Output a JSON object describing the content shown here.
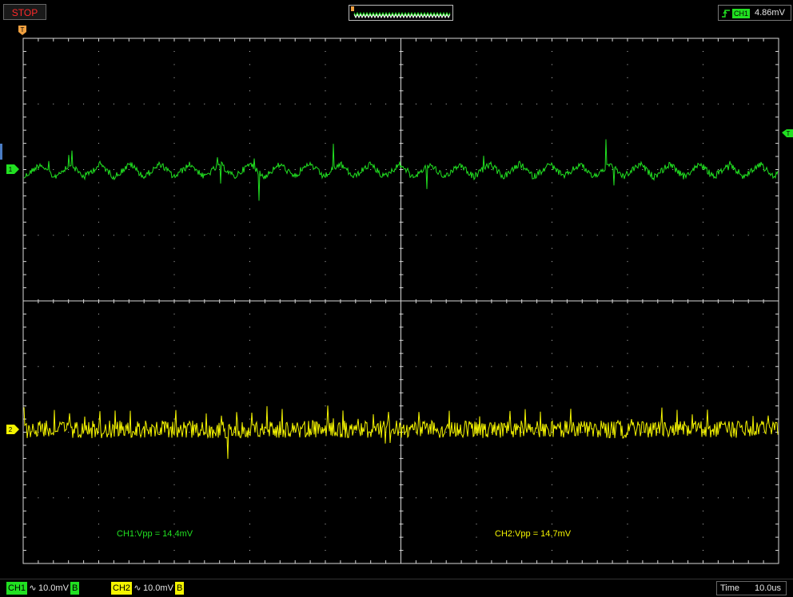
{
  "status": {
    "label": "STOP",
    "color": "#ff2a2a"
  },
  "trigger": {
    "channel": "CH1",
    "level": "4.86mV",
    "marker": "T",
    "edge_icon": "rising-edge-icon"
  },
  "channels": [
    {
      "id": "CH1",
      "marker": "1",
      "scale": "10.0mV",
      "coupling_icon": "ac-coupling-icon",
      "bw": "B",
      "color": "#21e021",
      "vpp_label": "CH1:Vpp = 14.4mV"
    },
    {
      "id": "CH2",
      "marker": "2",
      "scale": "10.0mV",
      "coupling_icon": "ac-coupling-icon",
      "bw": "B",
      "color": "#f4f400",
      "vpp_label": "CH2:Vpp = 14.7mV"
    }
  ],
  "timebase": {
    "label": "Time",
    "value": "10.0us"
  },
  "colors": {
    "ch1": "#21e021",
    "ch2": "#f4f400",
    "grid": "#d8d8d8",
    "trigger_marker": "#f0a040"
  }
}
